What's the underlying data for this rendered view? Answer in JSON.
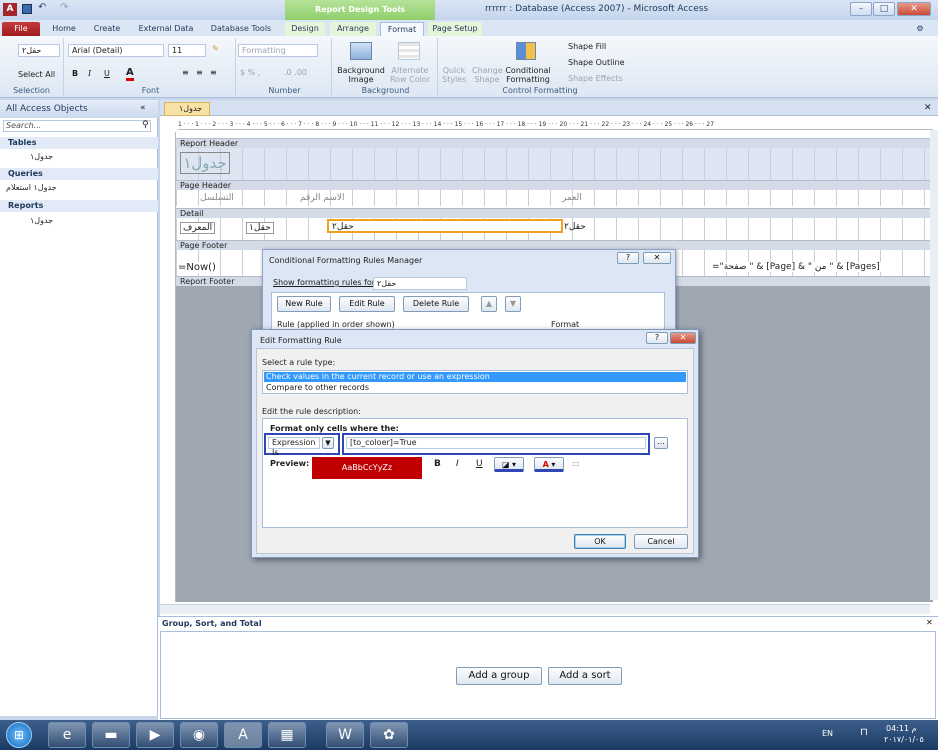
{
  "window": {
    "context_tool": "Report Design Tools",
    "title": "rrrrrr : Database (Access 2007) - Microsoft Access",
    "min": "–",
    "max": "□",
    "close": "✕"
  },
  "tabs": {
    "file": "File",
    "home": "Home",
    "create": "Create",
    "external": "External Data",
    "dbtools": "Database Tools",
    "design": "Design",
    "arrange": "Arrange",
    "format": "Format",
    "pagesetup": "Page Setup"
  },
  "ribbon": {
    "selection": {
      "object": "حقل٢",
      "select_all": "Select All",
      "label": "Selection"
    },
    "font": {
      "name": "Arial (Detail)",
      "size": "11",
      "bold": "B",
      "italic": "I",
      "underline": "U",
      "label": "Font"
    },
    "number": {
      "format": "Formatting",
      "label": "Number"
    },
    "background": {
      "image": "Background Image",
      "alt": "Alternate Row Color",
      "label": "Background"
    },
    "control": {
      "quick": "Quick Styles",
      "change": "Change Shape",
      "cond": "Conditional Formatting",
      "fill": "Shape Fill",
      "outline": "Shape Outline",
      "effects": "Shape Effects",
      "label": "Control Formatting"
    }
  },
  "nav": {
    "title": "All Access Objects",
    "search": "Search...",
    "tables": "Tables",
    "table1": "جدول١",
    "queries": "Queries",
    "query1": "جدول١ استعلام",
    "reports": "Reports",
    "report1": "جدول١"
  },
  "doc": {
    "tab": "جدول١",
    "ruler": "1 · · · 1 · · · 2 · · · 3 · · · 4 · · · 5 · · · 6 · · · 7 · · · 8 · · · 9 · · · 10 · · · 11 · · · 12 · · · 13 · · · 14 · · · 15 · · · 16 · · · 17 · · · 18 · · · 19 · · · 20 · · · 21 · · · 22 · · · 23 · · · 24 · · · 25 · · · 26 · · · 27",
    "report_header": "Report Header",
    "title_label": "جدول١",
    "page_header": "Page Header",
    "ph_serial": "التسلسل",
    "ph_name": "الاسم الرقم",
    "ph_age": "العمر",
    "detail": "Detail",
    "d_f1": "المعرف",
    "d_f2": "حقل١",
    "d_f3": "حقل٢",
    "d_f4": "حقل٢",
    "page_footer": "Page Footer",
    "now": "=Now()",
    "pages": "=\"صفحة \" & [Page] & \" من \" & [Pages]",
    "report_footer": "Report Footer"
  },
  "cfmgr": {
    "title": "Conditional Formatting Rules Manager",
    "show_label": "Show formatting rules for:",
    "show_value": "حقل٢",
    "new": "New Rule",
    "edit": "Edit Rule",
    "delete": "Delete Rule",
    "col_rule": "Rule (applied in order shown)",
    "col_format": "Format"
  },
  "dialog": {
    "title": "Edit Formatting Rule",
    "select_type": "Select a rule type:",
    "opt1": "Check values in the current record or use an expression",
    "opt2": "Compare to other records",
    "edit_desc": "Edit the rule description:",
    "format_only": "Format only cells where the:",
    "expr_type": "Expression Is",
    "expression": "[to_coloer]=True",
    "preview_label": "Preview:",
    "preview_text": "AaBbCcYyZz",
    "bold": "B",
    "italic": "I",
    "underline": "U",
    "ok": "OK",
    "cancel": "Cancel",
    "help": "?",
    "close": "✕"
  },
  "grouping": {
    "title": "Group, Sort, and Total",
    "add_group": "Add a group",
    "add_sort": "Add a sort"
  },
  "taskbar": {
    "lang": "EN",
    "time": "04:11 م",
    "date": "٢٠١٧/٠١/٠٥"
  },
  "colors": {
    "preview_bg": "#c00000",
    "highlight": "#2f46b4",
    "orange": "#f0a020",
    "selection": "#3399ff"
  }
}
